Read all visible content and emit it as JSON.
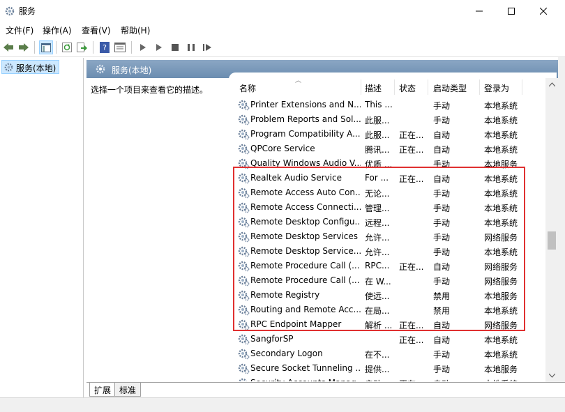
{
  "window": {
    "title": "服务",
    "minimize_icon": "minimize-icon",
    "maximize_icon": "maximize-icon",
    "close_icon": "close-icon"
  },
  "menu": {
    "items": [
      "文件(F)",
      "操作(A)",
      "查看(V)",
      "帮助(H)"
    ]
  },
  "toolbar": {
    "icons": [
      "back-icon",
      "forward-icon",
      "show-hide-tree-icon",
      "refresh-icon",
      "export-icon",
      "help-icon",
      "properties-icon",
      "start-icon",
      "start-alt-icon",
      "stop-icon",
      "pause-icon",
      "resume-icon"
    ]
  },
  "tree": {
    "node_label": "服务(本地)"
  },
  "scope": {
    "header_label": "服务(本地)",
    "description_prompt": "选择一个项目来查看它的描述。"
  },
  "columns": [
    "名称",
    "描述",
    "状态",
    "启动类型",
    "登录为"
  ],
  "rows": [
    {
      "name": "Printer Extensions and N...",
      "desc": "This ...",
      "status": "",
      "startup": "手动",
      "logon": "本地系统"
    },
    {
      "name": "Problem Reports and Sol...",
      "desc": "此服...",
      "status": "",
      "startup": "手动",
      "logon": "本地系统"
    },
    {
      "name": "Program Compatibility A...",
      "desc": "此服...",
      "status": "正在...",
      "startup": "自动",
      "logon": "本地系统"
    },
    {
      "name": "QPCore Service",
      "desc": "腾讯...",
      "status": "正在...",
      "startup": "自动",
      "logon": "本地系统"
    },
    {
      "name": "Quality Windows Audio V...",
      "desc": "优质 ...",
      "status": "",
      "startup": "手动",
      "logon": "本地服务"
    },
    {
      "name": "Realtek Audio Service",
      "desc": "For ...",
      "status": "正在...",
      "startup": "自动",
      "logon": "本地系统"
    },
    {
      "name": "Remote Access Auto Con...",
      "desc": "无论...",
      "status": "",
      "startup": "手动",
      "logon": "本地系统"
    },
    {
      "name": "Remote Access Connecti...",
      "desc": "管理...",
      "status": "",
      "startup": "手动",
      "logon": "本地系统"
    },
    {
      "name": "Remote Desktop Configu...",
      "desc": "远程...",
      "status": "",
      "startup": "手动",
      "logon": "本地系统"
    },
    {
      "name": "Remote Desktop Services",
      "desc": "允许...",
      "status": "",
      "startup": "手动",
      "logon": "网络服务"
    },
    {
      "name": "Remote Desktop Service...",
      "desc": "允许...",
      "status": "",
      "startup": "手动",
      "logon": "本地系统"
    },
    {
      "name": "Remote Procedure Call (...",
      "desc": "RPC...",
      "status": "正在...",
      "startup": "自动",
      "logon": "网络服务"
    },
    {
      "name": "Remote Procedure Call (...",
      "desc": "在 W...",
      "status": "",
      "startup": "手动",
      "logon": "网络服务"
    },
    {
      "name": "Remote Registry",
      "desc": "使远...",
      "status": "",
      "startup": "禁用",
      "logon": "本地服务"
    },
    {
      "name": "Routing and Remote Acc...",
      "desc": "在局...",
      "status": "",
      "startup": "禁用",
      "logon": "本地系统"
    },
    {
      "name": "RPC Endpoint Mapper",
      "desc": "解析 ...",
      "status": "正在...",
      "startup": "自动",
      "logon": "网络服务"
    },
    {
      "name": "SangforSP",
      "desc": "",
      "status": "正在...",
      "startup": "自动",
      "logon": "本地系统"
    },
    {
      "name": "Secondary Logon",
      "desc": "在不...",
      "status": "",
      "startup": "手动",
      "logon": "本地系统"
    },
    {
      "name": "Secure Socket Tunneling ...",
      "desc": "提供...",
      "status": "",
      "startup": "手动",
      "logon": "本地服务"
    },
    {
      "name": "Security Accounts Manag...",
      "desc": "启动...",
      "status": "正在...",
      "startup": "自动",
      "logon": "本地系统"
    }
  ],
  "tabs": [
    "扩展",
    "标准"
  ],
  "highlight_color": "#e03030",
  "header_color": "#7b9aba"
}
